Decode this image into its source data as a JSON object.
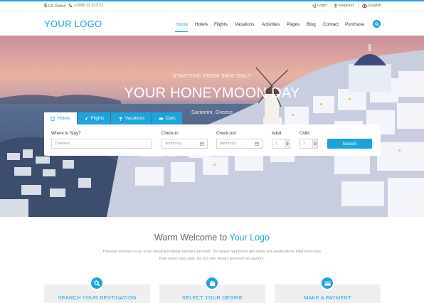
{
  "topbar": {
    "currency": "US Dollar",
    "phone": "+1900 12 213 21",
    "login": "Login",
    "register": "Register",
    "language": "English"
  },
  "header": {
    "logo": "YOUR LOGO",
    "nav": [
      "Home",
      "Hotels",
      "Flights",
      "Vacations",
      "Activities",
      "Pages",
      "Blog",
      "Contact",
      "Purchase"
    ],
    "active_nav": "Home"
  },
  "hero": {
    "kicker": "STARTING FROM $400 ONLY",
    "title": "YOUR HONEYMOON DAY",
    "subtitle": "Santorini, Greece"
  },
  "search": {
    "tabs": [
      "Hotels",
      "Flights",
      "Vacations",
      "Cars"
    ],
    "active_tab": "Hotels",
    "where_label": "Where to Stay?",
    "where_value": "Thailand",
    "checkin_label": "Check-in",
    "checkin_placeholder": "dd/mm/yy",
    "checkout_label": "Check-out",
    "checkout_placeholder": "dd/mm/yy",
    "adult_label": "Adult",
    "adult_value": "1",
    "child_label": "Child",
    "child_value": "1",
    "button": "Search"
  },
  "welcome": {
    "prefix": "Warm Welcome to",
    "brand": "Your Logo",
    "line1": "Pleased anxious or as in by viewing forbade minutes prevent. Too leave had those get being led weeks blind. Had men rose",
    "line2": "from down lady able. Its son him ferrars proceed six parlors."
  },
  "features": [
    {
      "title": "SEARCH YOUR DESTINATION",
      "icon": "search-icon"
    },
    {
      "title": "SELECT YOUR DESIRE",
      "icon": "suitcase-icon"
    },
    {
      "title": "MAKE A PAYMENT",
      "icon": "credit-card-icon"
    }
  ],
  "colors": {
    "accent": "#1fa3db",
    "card_bg": "#efefef"
  }
}
